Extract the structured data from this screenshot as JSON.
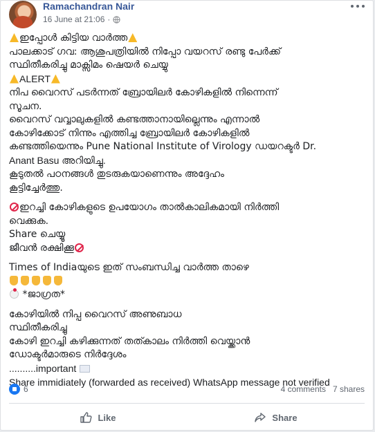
{
  "post": {
    "author": "Ramachandran Nair",
    "timestamp": "16 June at 21:06",
    "separator": "·",
    "privacy_icon": "globe-icon",
    "lines": [
      {
        "pre": "warning-icon",
        "text": "ഇപ്പോൾ കിട്ടിയ വാർത്ത",
        "post": "warning-icon"
      },
      {
        "text": "പാലക്കാട് ഗവ: ആശുപത്രിയിൽ നിപ്പോ വയറസ് രണ്ടു പേർക്ക്"
      },
      {
        "text": "സ്ഥിതീകരിച്ചു മാക്സിമം ഷെയർ ചെയ്യു"
      },
      {
        "pre": "warning-icon",
        "text": "ALERT",
        "post": "warning-icon",
        "latin": true
      },
      {
        "text": "നിപ വൈറസ് പടർന്നത് ബ്രോയിലർ കോഴികളിൽ നിന്നെന്ന്"
      },
      {
        "text": "സൂചന."
      },
      {
        "text": "വൈറസ് വവ്വാലുകളിൽ കണ്ടത്താനായില്ലെന്നും എന്നാൽ"
      },
      {
        "text": "കോഴിക്കോട് നിന്നും എത്തിച്ച ബ്രോയിലർ കോഴികളിൽ"
      },
      {
        "text": "കണ്ടത്തിയെന്നും Pune National Institute of Virology ഡയറക്ടർ Dr."
      },
      {
        "text": "Anant Basu അറിയിച്ചു.",
        "latin": true
      },
      {
        "text": "കൂടുതൽ പഠനങ്ങൾ തുടരുകയാണെന്നും അദ്ദേഹം"
      },
      {
        "text": "കൂട്ടിച്ചേർത്തു."
      },
      {
        "gap": true
      },
      {
        "pre": "no-entry-icon",
        "text": "ഇറച്ചി കോഴികളുടെ ഉപയോഗം താൽകാലികമായി നിർത്തി"
      },
      {
        "text": "വെക്കുക."
      },
      {
        "text": "Share ചെയ്യൂ"
      },
      {
        "text": "ജീവൻ രക്ഷിക്കൂ",
        "post": "no-entry-icon"
      },
      {
        "gap": true
      },
      {
        "text": "Times of Indiaയുടെ ഇത് സംബന്ധിച്ച വാർത്ത താഴെ"
      },
      {
        "hands": 5
      },
      {
        "pre": "chicken-icon",
        "text": " *ജാഗ്രത*"
      },
      {
        "gap": true
      },
      {
        "text": "കോഴിയിൽ നിപ്പ വൈറസ് അണുബാധ"
      },
      {
        "text": "സ്ഥിതീകരിച്ചു"
      },
      {
        "text": "കോഴി ഇറച്ചി കഴിക്കുന്നത് തത്കാലം നിർത്തി വെയ്ക്കാൻ"
      },
      {
        "text": "ഡോക്ടർമാരുടെ നിർദ്ദേശം"
      },
      {
        "text": "..........important ",
        "post": "envelope-icon",
        "latin": true
      },
      {
        "text": "Share immidiately (forwarded as received) WhatsApp message not verified",
        "latin": true
      }
    ]
  },
  "stats": {
    "likes": "6",
    "comments": "4 comments",
    "shares": "7 shares"
  },
  "actions": {
    "like_label": "Like",
    "share_label": "Share"
  },
  "colors": {
    "author": "#385898",
    "text": "#1c1e21",
    "muted": "#606770",
    "like_blue": "#1877f2"
  }
}
